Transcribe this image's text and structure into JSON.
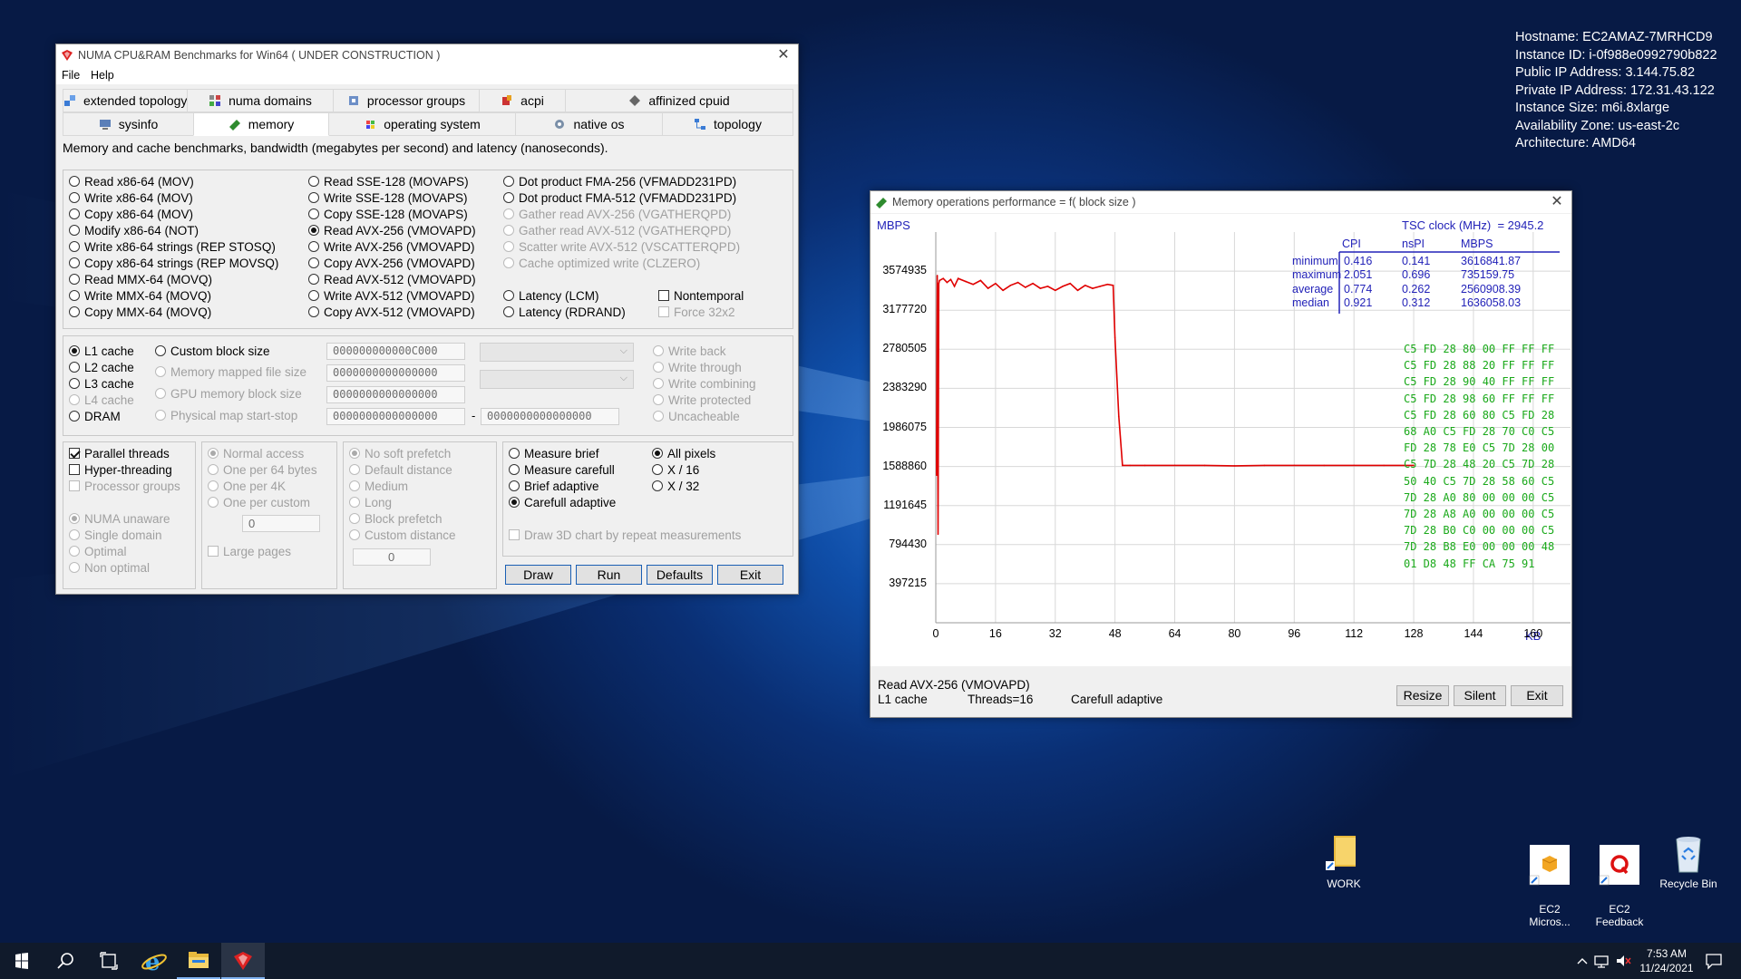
{
  "desktop": {
    "info": [
      "Hostname: EC2AMAZ-7MRHCD9",
      "Instance ID: i-0f988e0992790b822",
      "Public IP Address: 3.144.75.82",
      "Private IP Address: 172.31.43.122",
      "Instance Size: m6i.8xlarge",
      "Availability Zone: us-east-2c",
      "Architecture: AMD64"
    ],
    "icons": [
      {
        "label": "WORK"
      },
      {
        "label": "EC2\nMicros..."
      },
      {
        "label": "EC2\nFeedback"
      },
      {
        "label": "Recycle Bin"
      }
    ]
  },
  "main": {
    "title": "NUMA CPU&RAM Benchmarks for Win64 ( UNDER CONSTRUCTION )",
    "menu": [
      "File",
      "Help"
    ],
    "tabs_row1": [
      "extended topology",
      "numa domains",
      "processor groups",
      "acpi",
      "affinized cpuid"
    ],
    "tabs_row2": [
      "sysinfo",
      "memory",
      "operating system",
      "native os",
      "topology"
    ],
    "description": "Memory and cache benchmarks, bandwidth (megabytes per second) and latency (nanoseconds).",
    "methods_col1": [
      "Read x86-64 (MOV)",
      "Write x86-64 (MOV)",
      "Copy x86-64 (MOV)",
      "Modify x86-64 (NOT)",
      "Write x86-64 strings (REP STOSQ)",
      "Copy x86-64 strings (REP MOVSQ)",
      "Read MMX-64 (MOVQ)",
      "Write MMX-64 (MOVQ)",
      "Copy MMX-64 (MOVQ)"
    ],
    "methods_col2": [
      "Read SSE-128 (MOVAPS)",
      "Write SSE-128 (MOVAPS)",
      "Copy SSE-128 (MOVAPS)",
      "Read AVX-256 (VMOVAPD)",
      "Write AVX-256 (VMOVAPD)",
      "Copy AVX-256 (VMOVAPD)",
      "Read AVX-512 (VMOVAPD)",
      "Write AVX-512 (VMOVAPD)",
      "Copy AVX-512 (VMOVAPD)"
    ],
    "methods_col3": [
      "Dot product FMA-256 (VFMADD231PD)",
      "Dot product FMA-512 (VFMADD231PD)",
      "Gather read AVX-256 (VGATHERQPD)",
      "Gather read AVX-512 (VGATHERQPD)",
      "Scatter write AVX-512 (VSCATTERQPD)",
      "Cache optimized write (CLZERO)"
    ],
    "latency": [
      "Latency (LCM)",
      "Latency (RDRAND)"
    ],
    "nontemporal": "Nontemporal",
    "force": "Force 32x2",
    "targets": [
      "L1 cache",
      "L2 cache",
      "L3 cache",
      "L4 cache",
      "DRAM"
    ],
    "sizes": [
      "Custom block size",
      "Memory mapped file size",
      "GPU memory block size",
      "Physical map start-stop"
    ],
    "size_values": [
      "000000000000C000",
      "0000000000000000",
      "0000000000000000",
      "0000000000000000",
      "0000000000000000"
    ],
    "dash": "-",
    "write_modes": [
      "Write back",
      "Write through",
      "Write combining",
      "Write protected",
      "Uncacheable"
    ],
    "threads": [
      "Parallel threads",
      "Hyper-threading",
      "Processor groups"
    ],
    "numa": [
      "NUMA unaware",
      "Single domain",
      "Optimal",
      "Non optimal"
    ],
    "access": [
      "Normal access",
      "One per 64 bytes",
      "One per 4K",
      "One per custom"
    ],
    "access_value": "0",
    "large_pages": "Large pages",
    "prefetch": [
      "No soft prefetch",
      "Default distance",
      "Medium",
      "Long",
      "Block prefetch",
      "Custom distance"
    ],
    "prefetch_value": "0",
    "measure": [
      "Measure brief",
      "Measure carefull",
      "Brief adaptive",
      "Carefull adaptive"
    ],
    "pixels": [
      "All pixels",
      "X / 16",
      "X / 32"
    ],
    "draw3d": "Draw 3D chart by repeat measurements",
    "buttons": [
      "Draw",
      "Run",
      "Defaults",
      "Exit"
    ]
  },
  "chartwin": {
    "title": "Memory operations performance = f( block size )",
    "status": {
      "line1": "Read AVX-256 (VMOVAPD)",
      "cache": "L1 cache",
      "threads": "Threads=16",
      "mode": "Carefull adaptive"
    },
    "buttons": [
      "Resize",
      "Silent",
      "Exit"
    ]
  },
  "chart_data": {
    "type": "line",
    "ylabel": "MBPS",
    "xlabel": "KB",
    "y_ticks": [
      3574935,
      3177720,
      2780505,
      2383290,
      1986075,
      1588860,
      1191645,
      794430,
      397215
    ],
    "x_ticks": [
      0,
      16,
      32,
      48,
      64,
      80,
      96,
      112,
      128,
      144,
      160
    ],
    "xlim": [
      0,
      170
    ],
    "ylim": [
      0,
      3972150
    ],
    "tsc_label": "TSC clock (MHz)  = 2945.2",
    "stats_headers": [
      "CPI",
      "nsPI",
      "MBPS"
    ],
    "stats_rows": [
      {
        "label": "minimum",
        "cpi": "0.416",
        "nspi": "0.141",
        "mbps": "3616841.87"
      },
      {
        "label": "maximum",
        "cpi": "2.051",
        "nspi": "0.696",
        "mbps": "735159.75"
      },
      {
        "label": "average",
        "cpi": "0.774",
        "nspi": "0.262",
        "mbps": "2560908.39"
      },
      {
        "label": "median",
        "cpi": "0.921",
        "nspi": "0.312",
        "mbps": "1636058.03"
      }
    ],
    "hex_dump": [
      "C5 FD 28 80 00 FF FF FF",
      "C5 FD 28 88 20 FF FF FF",
      "C5 FD 28 90 40 FF FF FF",
      "C5 FD 28 98 60 FF FF FF",
      "C5 FD 28 60 80 C5 FD 28",
      "68 A0 C5 FD 28 70 C0 C5",
      "FD 28 78 E0 C5 7D 28 00",
      "C5 7D 28 48 20 C5 7D 28",
      "50 40 C5 7D 28 58 60 C5",
      "7D 28 A0 80 00 00 00 C5",
      "7D 28 A8 A0 00 00 00 C5",
      "7D 28 B0 C0 00 00 00 C5",
      "7D 28 B8 E0 00 00 00 48",
      "01 D8 48 FF CA 75 91"
    ],
    "series": [
      {
        "color": "#e00000",
        "x": [
          0.2,
          0.4,
          0.6,
          0.8,
          1,
          2,
          3,
          4,
          5,
          6,
          8,
          10,
          12,
          14,
          16,
          18,
          20,
          22,
          24,
          26,
          28,
          30,
          32,
          34,
          36,
          38,
          40,
          42,
          44,
          46,
          47.5,
          48,
          49,
          50,
          52,
          56,
          64,
          72,
          80,
          88,
          96,
          104,
          112,
          120,
          128
        ],
        "y": [
          1500000,
          3530000,
          900000,
          3450000,
          3480000,
          3500000,
          3460000,
          3490000,
          3420000,
          3500000,
          3470000,
          3440000,
          3480000,
          3400000,
          3450000,
          3380000,
          3430000,
          3460000,
          3410000,
          3450000,
          3400000,
          3420000,
          3380000,
          3420000,
          3450000,
          3380000,
          3430000,
          3400000,
          3420000,
          3440000,
          3430000,
          2900000,
          2100000,
          1600000,
          1600000,
          1600000,
          1600000,
          1600000,
          1595000,
          1600000,
          1600000,
          1600000,
          1600000,
          1600000,
          1600000
        ]
      }
    ]
  },
  "taskbar": {
    "time": "7:53 AM",
    "date": "11/24/2021"
  }
}
